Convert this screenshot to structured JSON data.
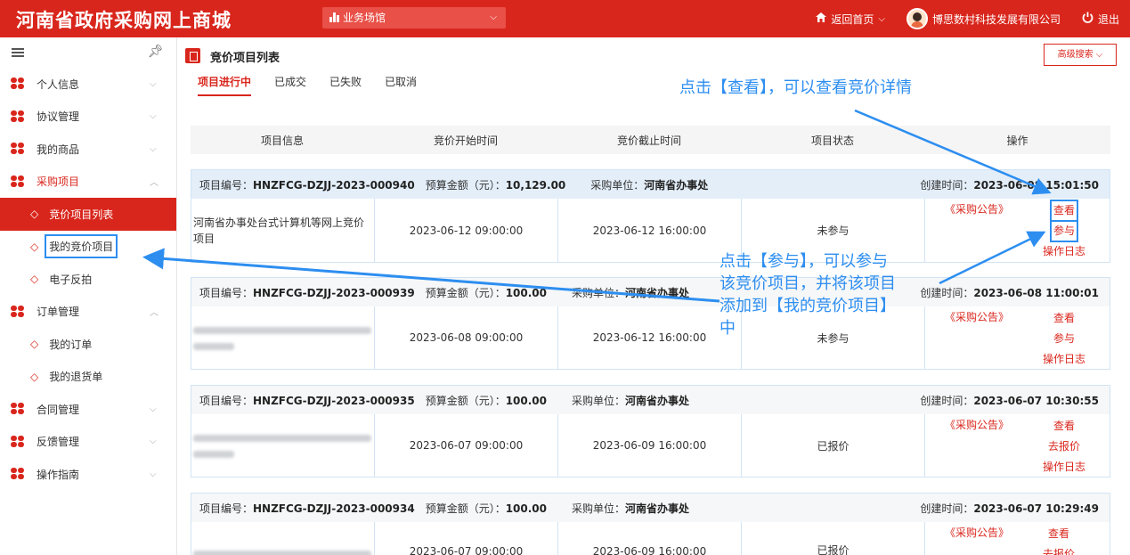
{
  "header": {
    "logo": "河南省政府采购网上商城",
    "business_select": "业务场馆",
    "home_link": "返回首页",
    "company": "博思数村科技发展有限公司",
    "logout": "退出"
  },
  "sidebar": {
    "items": [
      {
        "label": "个人信息",
        "level": "top",
        "expanded": false
      },
      {
        "label": "协议管理",
        "level": "top",
        "expanded": false
      },
      {
        "label": "我的商品",
        "level": "top",
        "expanded": false
      },
      {
        "label": "采购项目",
        "level": "top",
        "expanded": true
      },
      {
        "label": "竞价项目列表",
        "level": "sub",
        "active": true
      },
      {
        "label": "我的竞价项目",
        "level": "sub",
        "highlighted": true
      },
      {
        "label": "电子反拍",
        "level": "sub"
      },
      {
        "label": "订单管理",
        "level": "top",
        "expanded": true
      },
      {
        "label": "我的订单",
        "level": "sub"
      },
      {
        "label": "我的退货单",
        "level": "sub"
      },
      {
        "label": "合同管理",
        "level": "top",
        "expanded": false
      },
      {
        "label": "反馈管理",
        "level": "top",
        "expanded": false
      },
      {
        "label": "操作指南",
        "level": "top",
        "expanded": false
      }
    ]
  },
  "main": {
    "title": "竞价项目列表",
    "advanced_search": "高级搜索",
    "tabs": [
      "项目进行中",
      "已成交",
      "已失败",
      "已取消"
    ],
    "active_tab": "项目进行中",
    "columns": [
      "项目信息",
      "竞价开始时间",
      "竞价截止时间",
      "项目状态",
      "操作"
    ],
    "labels": {
      "project_no": "项目编号：",
      "budget": "预算金额（元）：",
      "unit": "采购单位：",
      "created": "创建时间："
    },
    "projects": [
      {
        "no": "HNZFCG-DZJJ-2023-000940",
        "budget": "10,129.00",
        "unit": "河南省办事处",
        "created": "2023-06-08 15:01:50",
        "name": "河南省办事处台式计算机等网上竞价项目",
        "start": "2023-06-12 09:00:00",
        "end": "2023-06-12 16:00:00",
        "status": "未参与",
        "notice": "《采购公告》",
        "actions": [
          "查看",
          "参与",
          "操作日志"
        ]
      },
      {
        "no": "HNZFCG-DZJJ-2023-000939",
        "budget": "100.00",
        "unit": "河南省办事处",
        "created": "2023-06-08 11:00:01",
        "name": "",
        "start": "2023-06-08 09:00:00",
        "end": "2023-06-12 16:00:00",
        "status": "未参与",
        "notice": "《采购公告》",
        "actions": [
          "查看",
          "参与",
          "操作日志"
        ]
      },
      {
        "no": "HNZFCG-DZJJ-2023-000935",
        "budget": "100.00",
        "unit": "河南省办事处",
        "created": "2023-06-07 10:30:55",
        "name": "",
        "start": "2023-06-07 09:00:00",
        "end": "2023-06-09 16:00:00",
        "status": "已报价",
        "notice": "《采购公告》",
        "actions": [
          "查看",
          "去报价",
          "操作日志"
        ]
      },
      {
        "no": "HNZFCG-DZJJ-2023-000934",
        "budget": "100.00",
        "unit": "河南省办事处",
        "created": "2023-06-07 10:29:49",
        "name": "",
        "start": "2023-06-07 09:00:00",
        "end": "2023-06-09 16:00:00",
        "status": "已报价",
        "notice": "《采购公告》",
        "actions": [
          "查看",
          "去报价"
        ]
      }
    ]
  },
  "annotations": {
    "view_tip": "点击【查看】，可以查看竞价详情",
    "join_tip": [
      "点击【参与】，可以参与",
      "该竞价项目，并将该项目",
      "添加到【我的竞价项目】",
      "中"
    ]
  },
  "colors": {
    "brand_red": "#d9261c",
    "annotation_blue": "#2d8ef0"
  },
  "icons": [
    "menu-icon",
    "pin-icon",
    "clover-icon",
    "doc-icon",
    "home-icon",
    "power-icon",
    "chevron-down-icon"
  ]
}
